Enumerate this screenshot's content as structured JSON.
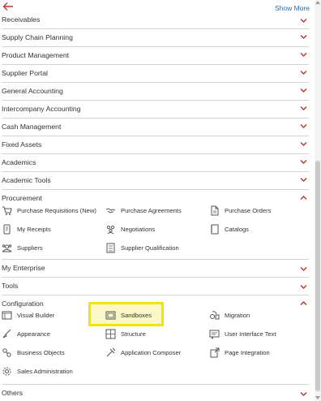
{
  "header": {
    "back_icon": "back-arrow-icon",
    "show_more": "Show More",
    "accent_color": "#c0392b",
    "link_color": "#1f6fb5"
  },
  "categories_top": [
    {
      "label": "Receivables",
      "expanded": false
    },
    {
      "label": "Supply Chain Planning",
      "expanded": false
    },
    {
      "label": "Product Management",
      "expanded": false
    },
    {
      "label": "Supplier Portal",
      "expanded": false
    },
    {
      "label": "General Accounting",
      "expanded": false
    },
    {
      "label": "Intercompany Accounting",
      "expanded": false
    },
    {
      "label": "Cash Management",
      "expanded": false
    },
    {
      "label": "Fixed Assets",
      "expanded": false
    },
    {
      "label": "Academics",
      "expanded": false
    },
    {
      "label": "Academic Tools",
      "expanded": false
    }
  ],
  "procurement": {
    "label": "Procurement",
    "expanded": true,
    "tasks": [
      {
        "label": "Purchase Requisitions (New)",
        "icon": "cart-icon"
      },
      {
        "label": "Purchase Agreements",
        "icon": "handshake-icon"
      },
      {
        "label": "Purchase Orders",
        "icon": "document-icon"
      },
      {
        "label": "My Receipts",
        "icon": "receipt-icon"
      },
      {
        "label": "Negotiations",
        "icon": "people-group-icon"
      },
      {
        "label": "Catalogs",
        "icon": "catalog-icon"
      },
      {
        "label": "Suppliers",
        "icon": "supplier-icon"
      },
      {
        "label": "Supplier Qualification",
        "icon": "checklist-icon"
      }
    ]
  },
  "categories_mid": [
    {
      "label": "My Enterprise",
      "expanded": false
    },
    {
      "label": "Tools",
      "expanded": false
    }
  ],
  "configuration": {
    "label": "Configuration",
    "expanded": true,
    "tasks": [
      {
        "label": "Visual Builder",
        "icon": "visual-builder-icon"
      },
      {
        "label": "Sandboxes",
        "icon": "sandbox-icon",
        "highlighted": true
      },
      {
        "label": "Migration",
        "icon": "migration-icon"
      },
      {
        "label": "Appearance",
        "icon": "brush-icon"
      },
      {
        "label": "Structure",
        "icon": "structure-icon"
      },
      {
        "label": "User Interface Text",
        "icon": "ui-text-icon"
      },
      {
        "label": "Business Objects",
        "icon": "business-objects-icon"
      },
      {
        "label": "Application Composer",
        "icon": "tools-icon"
      },
      {
        "label": "Page Integration",
        "icon": "page-integration-icon"
      },
      {
        "label": "Sales Administration",
        "icon": "gear-icon"
      }
    ]
  },
  "categories_bottom": [
    {
      "label": "Others",
      "expanded": false
    }
  ],
  "highlight_color": "#f2e600"
}
